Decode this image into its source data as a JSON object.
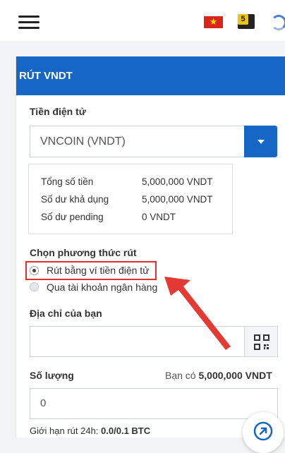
{
  "header": {
    "menu_icon": "hamburger-menu-icon",
    "flag_icon": "vietnam-flag-icon",
    "notification_badge": "5",
    "avatar_icon": "user-avatar-icon"
  },
  "card": {
    "title": "RÚT VNDT",
    "currency_label": "Tiền điện tử",
    "currency_selected": "VNCOIN (VNDT)",
    "balances": [
      {
        "label": "Tổng số tiền",
        "value": "5,000,000 VNDT"
      },
      {
        "label": "Số dư khả dụng",
        "value": "5,000,000 VNDT"
      },
      {
        "label": "Số dư pending",
        "value": "0 VNDT"
      }
    ],
    "method_label": "Chọn phương thức rút",
    "methods": [
      {
        "label": "Rút bằng ví tiền điện tử",
        "checked": true
      },
      {
        "label": "Qua tài khoản ngân hàng",
        "checked": false
      }
    ],
    "address_label": "Địa chỉ của bạn",
    "address_value": "",
    "amount_label": "Số lượng",
    "available_prefix": "Bạn có",
    "available_amount": "5,000,000 VNDT",
    "amount_value": "0",
    "limit_prefix": "Giới hạn rút 24h:",
    "limit_value": "0.0/0.1 BTC"
  },
  "colors": {
    "primary": "#1666c5",
    "highlight": "#e0322d"
  }
}
